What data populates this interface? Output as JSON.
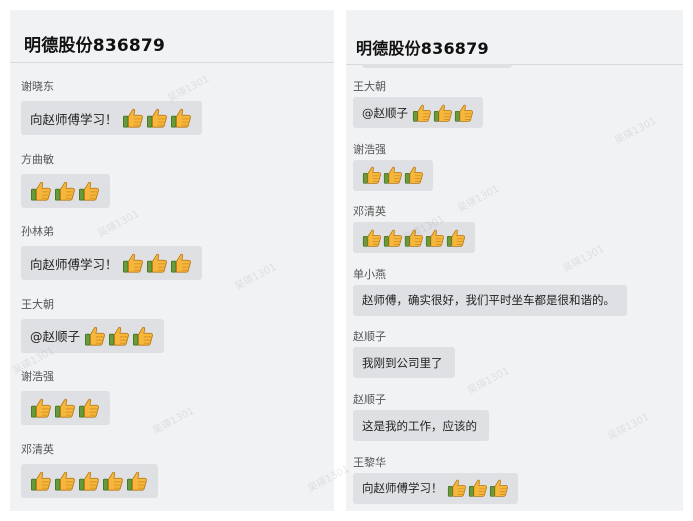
{
  "watermark": "吴瑛1301",
  "left_panel": {
    "title": "明德股份836879",
    "messages": [
      {
        "sender": "谢晓东",
        "text": "向赵师傅学习！",
        "thumbs": 3
      },
      {
        "sender": "方曲敏",
        "text": "",
        "thumbs": 3
      },
      {
        "sender": "孙林弟",
        "text": "向赵师傅学习！",
        "thumbs": 3
      },
      {
        "sender": "王大朝",
        "text": "@赵顺子",
        "thumbs": 3
      },
      {
        "sender": "谢浩强",
        "text": "",
        "thumbs": 3
      },
      {
        "sender": "邓清英",
        "text": "",
        "thumbs": 5
      }
    ]
  },
  "right_panel": {
    "title": "明德股份836879",
    "messages": [
      {
        "sender": "王大朝",
        "text": "@赵顺子",
        "thumbs": 3
      },
      {
        "sender": "谢浩强",
        "text": "",
        "thumbs": 3
      },
      {
        "sender": "邓清英",
        "text": "",
        "thumbs": 5
      },
      {
        "sender": "单小燕",
        "text": "赵师傅，确实很好，我们平时坐车都是很和谐的。",
        "thumbs": 0
      },
      {
        "sender": "赵顺子",
        "text": "我刚到公司里了",
        "thumbs": 0
      },
      {
        "sender": "赵顺子",
        "text": "这是我的工作，应该的",
        "thumbs": 0
      },
      {
        "sender": "王黎华",
        "text": "向赵师傅学习！",
        "thumbs": 3
      }
    ]
  },
  "icons": {
    "thumb": "thumbs-up-icon"
  },
  "colors": {
    "panel_bg": "#f1f2f4",
    "bubble_bg": "#dfe0e4",
    "thumb_yellow": "#f6b73c",
    "thumb_cuff": "#6a9a3a"
  }
}
